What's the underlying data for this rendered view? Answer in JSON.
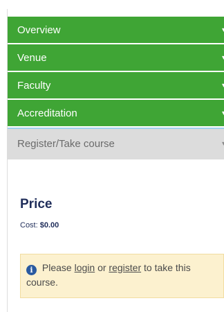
{
  "accordion": {
    "items": [
      {
        "label": "Overview"
      },
      {
        "label": "Venue"
      },
      {
        "label": "Faculty"
      },
      {
        "label": "Accreditation"
      },
      {
        "label": "Register/Take course"
      }
    ],
    "chevron": "▾"
  },
  "price": {
    "title": "Price",
    "cost_label": "Cost:",
    "cost_value": "$0.00"
  },
  "notice": {
    "icon": "i",
    "text_before": "Please",
    "login_link": "login",
    "text_middle": "or",
    "register_link": "register",
    "text_after": "to take this course."
  },
  "colors": {
    "accordion_green": "#3fa535",
    "active_tab_gray": "#dcdcdc",
    "notice_background": "#fcf1cf",
    "heading_navy": "#1f2d5a",
    "info_icon_blue": "#2a5aa0"
  }
}
